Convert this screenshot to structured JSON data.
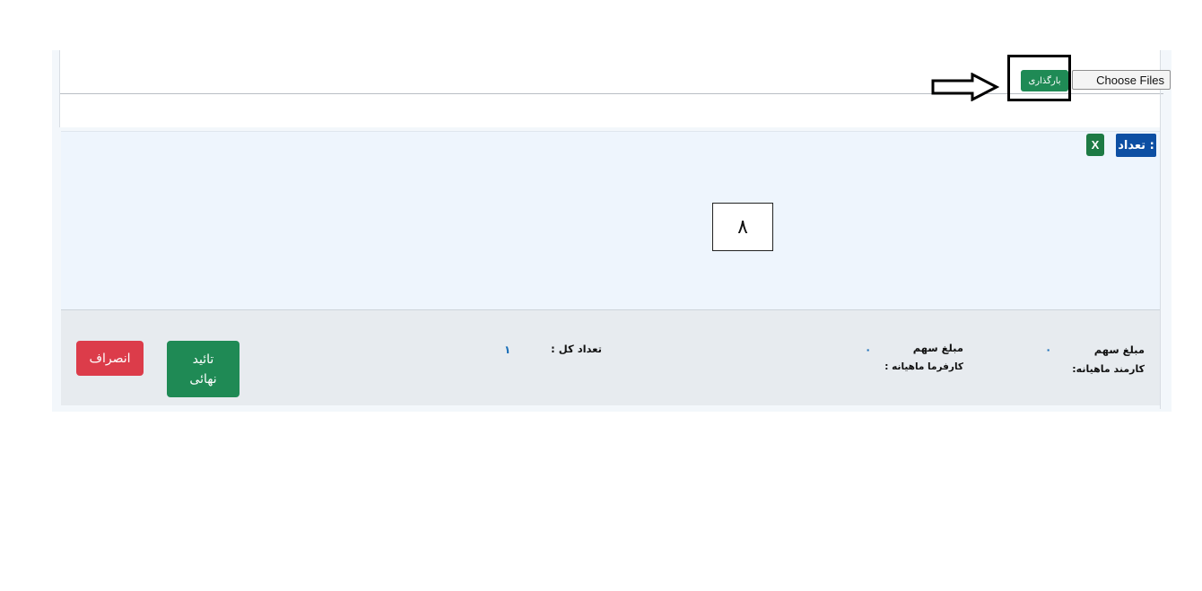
{
  "upload": {
    "choose_files_label": "Choose Files",
    "upload_button_label": "بارگذاری"
  },
  "list": {
    "count_label": "تعداد :",
    "excel_icon_letter": "X",
    "step_marker": "۸"
  },
  "footer": {
    "employee_share_label_line1": "مبلغ سهم",
    "employee_share_label_line2": "کارمند ماهیانه:",
    "employee_share_value": "۰",
    "employer_share_label_line1": "مبلغ سهم",
    "employer_share_label_line2": "کارفرما ماهیانه :",
    "employer_share_value": "۰",
    "total_count_label": "تعداد کل :",
    "total_count_value": "۱",
    "confirm_button_line1": "تائید",
    "confirm_button_line2": "نهائی",
    "cancel_button_label": "انصراف"
  },
  "colors": {
    "upload_button": "#1f8a55",
    "count_badge": "#0d4fa3",
    "confirm_button": "#1f8a55",
    "cancel_button": "#dc3c4a",
    "value_text": "#1b6fb8"
  }
}
